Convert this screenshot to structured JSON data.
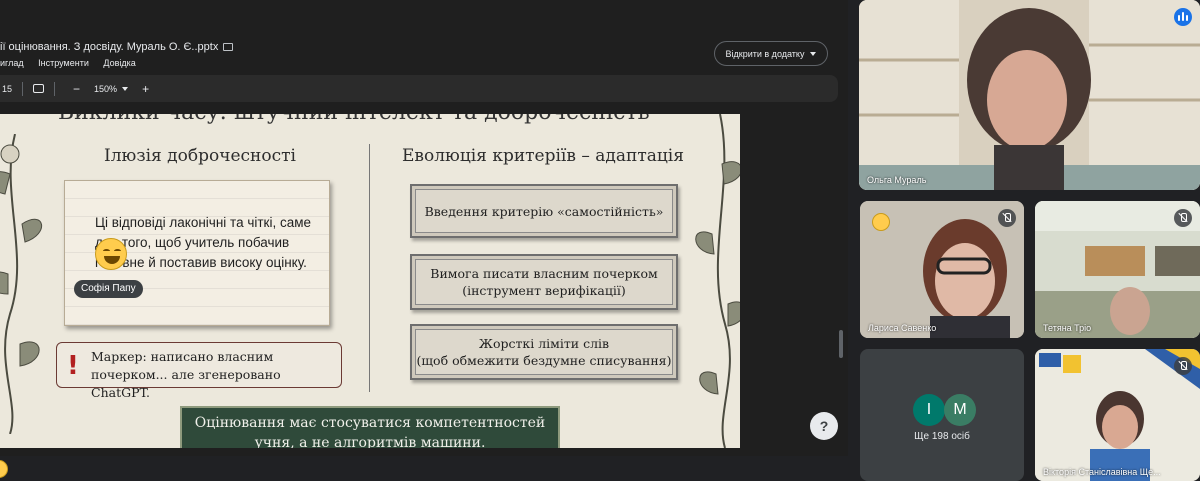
{
  "document": {
    "title": "ії оцінювання. З досвіду. Мураль О. Є..pptx",
    "menu": [
      "иглад",
      "Інструменти",
      "Довідка"
    ],
    "open_button": "Відкрити в додатку",
    "page_indicator": "15",
    "zoom": "150%"
  },
  "slide": {
    "heading": "Виклики часу: штучний інтелект та доброчесність",
    "left_title": "Ілюзія доброчесності",
    "right_title": "Еволюція критеріїв – адаптація",
    "note_text": "Ці відповіді лаконічні та чіткі, саме для того, щоб учитель побачив головне й поставив високу оцінку.",
    "marker_symbol": "!",
    "marker_line1": "Маркер: написано власним",
    "marker_line2": "почерком... але згенеровано ChatGPT.",
    "criteria": [
      {
        "line1": "Введення критерію «самостійність»",
        "line2": ""
      },
      {
        "line1": "Вимога писати власним почерком",
        "line2": "(інструмент верифікації)"
      },
      {
        "line1": "Жорсткі ліміти слів",
        "line2": "(щоб обмежити бездумне списування)"
      }
    ],
    "banner_line1": "Оцінювання має стосуватися компетентностей",
    "banner_line2": "учня, а не алгоритмів машини."
  },
  "overlay": {
    "reaction_name": "Софія Папу",
    "help_symbol": "?"
  },
  "participants": {
    "main": {
      "name": "Ольга Мураль"
    },
    "tiles": [
      {
        "name": "Лариса Савенко"
      },
      {
        "name": "Тетяна Тріо"
      },
      {
        "name": "Вікторія Станіславівна Ще..."
      }
    ],
    "more": {
      "avatars": [
        "I",
        "M"
      ],
      "label": "Ще 198 осіб"
    }
  },
  "colors": {
    "background": "#202124",
    "tile": "#3c4043",
    "accent": "#1a73e8",
    "banner": "#2f4a3a",
    "avatar_i": "#00796b",
    "avatar_m": "#3a7d64"
  }
}
